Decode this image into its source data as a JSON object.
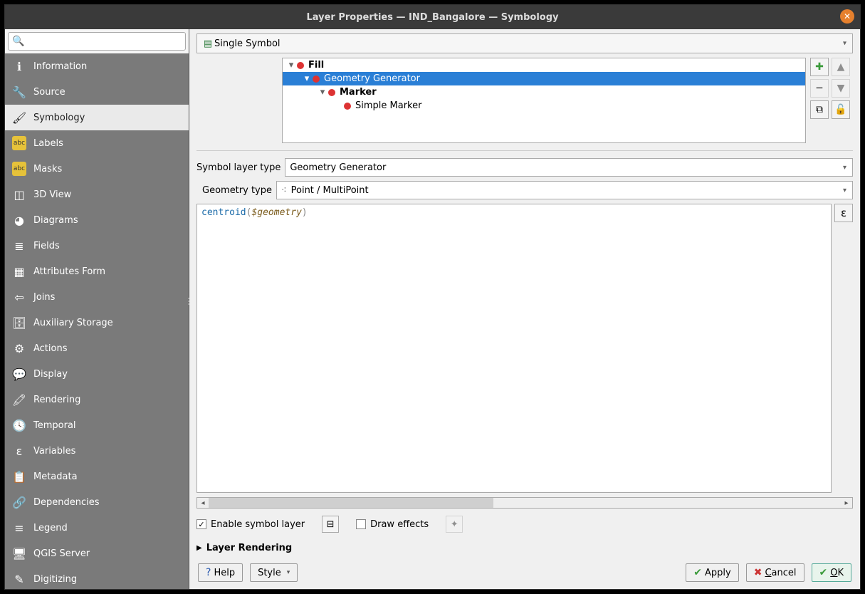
{
  "window": {
    "title": "Layer Properties — IND_Bangalore — Symbology"
  },
  "sidebar": {
    "search_placeholder": "",
    "items": [
      {
        "label": "Information",
        "icon": "ℹ"
      },
      {
        "label": "Source",
        "icon": "🔧"
      },
      {
        "label": "Symbology",
        "icon": "🖌"
      },
      {
        "label": "Labels",
        "icon": "abc"
      },
      {
        "label": "Masks",
        "icon": "abc"
      },
      {
        "label": "3D View",
        "icon": "◫"
      },
      {
        "label": "Diagrams",
        "icon": "◕"
      },
      {
        "label": "Fields",
        "icon": "≣"
      },
      {
        "label": "Attributes Form",
        "icon": "▦"
      },
      {
        "label": "Joins",
        "icon": "⇦"
      },
      {
        "label": "Auxiliary Storage",
        "icon": "🗄"
      },
      {
        "label": "Actions",
        "icon": "⚙"
      },
      {
        "label": "Display",
        "icon": "💬"
      },
      {
        "label": "Rendering",
        "icon": "🖍"
      },
      {
        "label": "Temporal",
        "icon": "🕓"
      },
      {
        "label": "Variables",
        "icon": "ε"
      },
      {
        "label": "Metadata",
        "icon": "📋"
      },
      {
        "label": "Dependencies",
        "icon": "🔗"
      },
      {
        "label": "Legend",
        "icon": "≡"
      },
      {
        "label": "QGIS Server",
        "icon": "🖥"
      },
      {
        "label": "Digitizing",
        "icon": "✎"
      }
    ],
    "selected_index": 2
  },
  "renderer": {
    "type": "Single Symbol"
  },
  "symbol_tree": {
    "items": [
      {
        "label": "Fill",
        "depth": 0,
        "bold": true,
        "expanded": true
      },
      {
        "label": "Geometry Generator",
        "depth": 1,
        "bold": false,
        "expanded": true,
        "selected": true
      },
      {
        "label": "Marker",
        "depth": 2,
        "bold": true,
        "expanded": true
      },
      {
        "label": "Simple Marker",
        "depth": 3,
        "bold": false
      }
    ]
  },
  "symbol_layer": {
    "type_label": "Symbol layer type",
    "type_value": "Geometry Generator",
    "geom_label": "Geometry type",
    "geom_value": "Point / MultiPoint",
    "expression_fn": "centroid",
    "expression_var": "$geometry"
  },
  "options": {
    "enable_layer_label": "Enable symbol layer",
    "enable_layer_checked": true,
    "draw_effects_label": "Draw effects",
    "draw_effects_checked": false
  },
  "collapse": {
    "layer_rendering": "Layer Rendering"
  },
  "footer": {
    "help": "Help",
    "style": "Style",
    "apply": "Apply",
    "cancel": "Cancel",
    "ok": "OK"
  }
}
